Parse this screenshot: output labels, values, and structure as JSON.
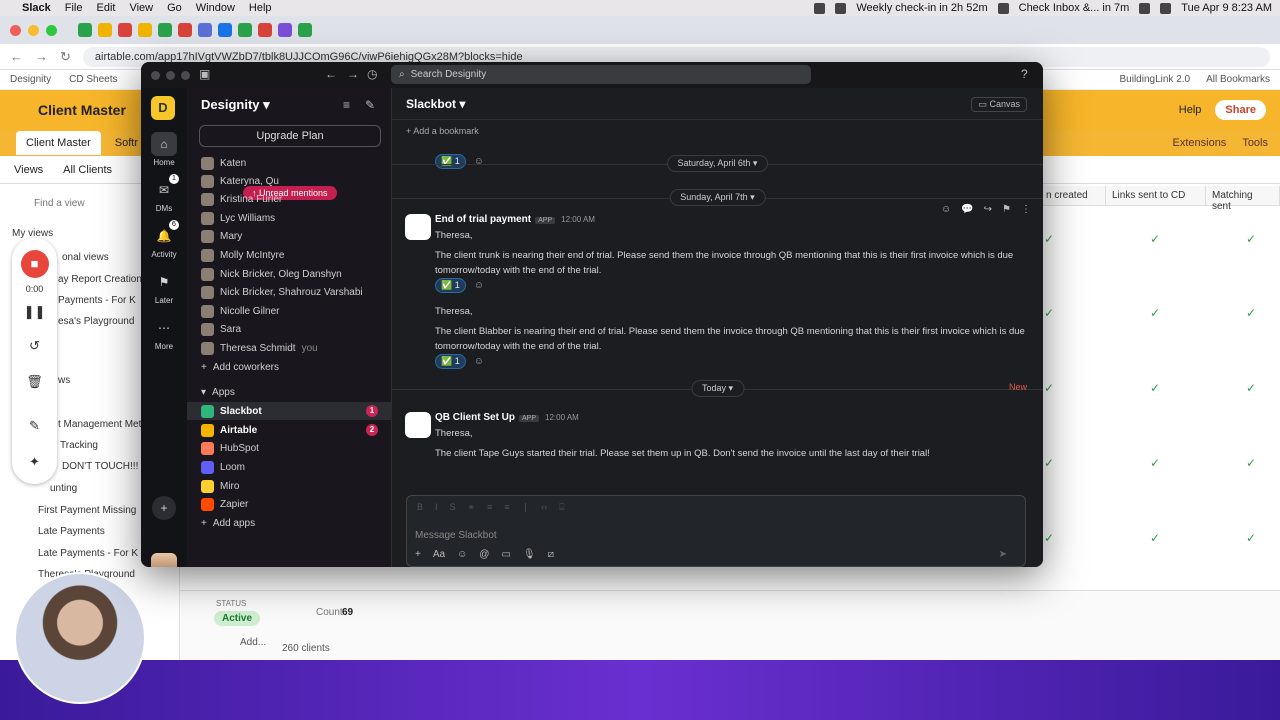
{
  "mac_menubar": {
    "app": "Slack",
    "menus": [
      "File",
      "Edit",
      "View",
      "Go",
      "Window",
      "Help"
    ],
    "meeting": "Weekly check-in in 2h 52m",
    "inbox": "Check Inbox &... in 7m",
    "datetime": "Tue Apr 9  8:23 AM"
  },
  "browser": {
    "url": "airtable.com/app17hIVgtVWZbD7/tblk8UJJCOmG96C/viwP6iehigQGx28M?blocks=hide",
    "bookmarks": [
      "Designity",
      "CD Sheets"
    ],
    "bookmarks_right": [
      "BuildingLink 2.0",
      "All Bookmarks"
    ]
  },
  "airtable": {
    "base_name": "Client Master",
    "tabs": [
      "Client Master",
      "Softr Use"
    ],
    "header_right": [
      "Help",
      "Share"
    ],
    "tabs_right": [
      "Extensions",
      "Tools"
    ],
    "toolbar": [
      "Views",
      "All Clients"
    ],
    "find_view": "Find a view",
    "my_views": "My views",
    "sidebar_items": [
      "onal views",
      "ay Report Creation",
      "Payments - For K",
      "esa's Playground",
      "ws",
      "t Management Metr",
      "Tracking",
      "DON'T TOUCH!!!",
      "unting",
      "First Payment Missing",
      "Late Payments",
      "Late Payments - For K",
      "Theresa's Playground"
    ],
    "col_headers": [
      "n created",
      "Links sent to CD",
      "Matching sent"
    ],
    "status_label": "STATUS",
    "status_value": "Active",
    "count_label": "Count",
    "count_value": "69",
    "clients_count": "260 clients",
    "add_label": "Add..."
  },
  "recorder": {
    "time": "0:00"
  },
  "slack": {
    "search_placeholder": "Search Designity",
    "workspace": "Designity",
    "upgrade": "Upgrade Plan",
    "unread_mentions": "Unread mentions",
    "rail": [
      {
        "label": "Home",
        "icon": "home-icon"
      },
      {
        "label": "DMs",
        "icon": "dm-icon",
        "badge": "1"
      },
      {
        "label": "Activity",
        "icon": "bell-icon",
        "badge": "6"
      },
      {
        "label": "Later",
        "icon": "bookmark-icon"
      },
      {
        "label": "More",
        "icon": "more-icon"
      }
    ],
    "dms": [
      "Katen",
      "Kateryna, Qu",
      "Kristina Furler",
      "Lyc Williams",
      "Mary",
      "Molly McIntyre",
      "Nick Bricker, Oleg Danshyn",
      "Nick Bricker, Shahrouz Varshabi",
      "Nicolle Gilner",
      "Sara",
      "Theresa Schmidt"
    ],
    "you_label": "you",
    "add_coworkers": "Add coworkers",
    "apps_heading": "Apps",
    "apps": [
      {
        "name": "Slackbot",
        "badge": "1",
        "active": true
      },
      {
        "name": "Airtable",
        "badge": "2",
        "active": false
      },
      {
        "name": "HubSpot",
        "badge": "",
        "active": false
      },
      {
        "name": "Loom",
        "badge": "",
        "active": false
      },
      {
        "name": "Miro",
        "badge": "",
        "active": false
      },
      {
        "name": "Zapier",
        "badge": "",
        "active": false
      }
    ],
    "add_apps": "Add apps",
    "channel": "Slackbot",
    "canvas": "Canvas",
    "add_bookmark": "Add a bookmark",
    "dates": [
      "Saturday, April 6th",
      "Sunday, April 7th",
      "Today"
    ],
    "new_label": "New",
    "reaction_count": "1",
    "messages": [
      {
        "author": "End of trial payment",
        "tag": "APP",
        "time": "12:00 AM",
        "greeting": "Theresa,",
        "body": "The client trunk is nearing their end of trial. Please send them the invoice through QB mentioning that this is their first invoice which is due tomorrow/today with the end of the trial."
      },
      {
        "greeting": "Theresa,",
        "body": "The client Blabber is nearing their end of trial. Please send them the invoice through QB mentioning that this is their first invoice which is due tomorrow/today with the end of the trial."
      },
      {
        "author": "QB Client Set Up",
        "tag": "APP",
        "time": "12:00 AM",
        "greeting": "Theresa,",
        "body": "The client Tape Guys started their trial. Please set them up in QB. Don't send the invoice until the last day of their trial!"
      }
    ],
    "composer_placeholder": "Message Slackbot"
  }
}
